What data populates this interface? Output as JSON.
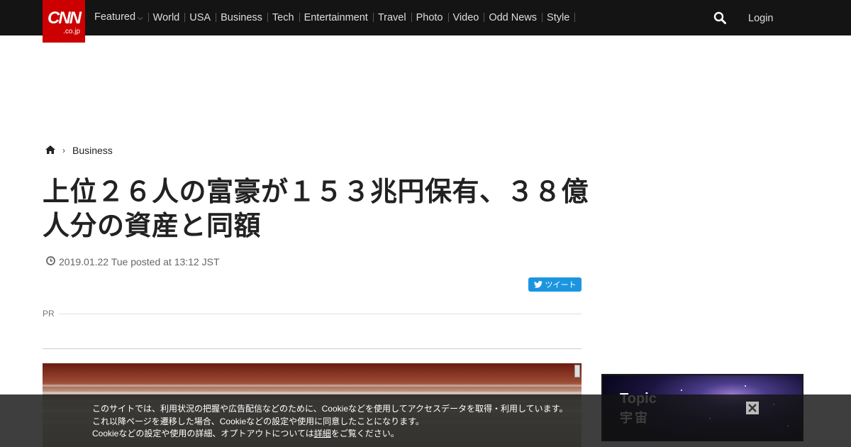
{
  "header": {
    "logo_main": "CNN",
    "logo_sub": ".co.jp",
    "nav": [
      {
        "label": "Featured",
        "has_dropdown": true
      },
      {
        "label": "World"
      },
      {
        "label": "USA"
      },
      {
        "label": "Business"
      },
      {
        "label": "Tech"
      },
      {
        "label": "Entertainment"
      },
      {
        "label": "Travel"
      },
      {
        "label": "Photo"
      },
      {
        "label": "Video"
      },
      {
        "label": "Odd News"
      },
      {
        "label": "Style"
      }
    ],
    "login_label": "Login",
    "search_icon": "search-icon"
  },
  "breadcrumb": {
    "home_icon": "home-icon",
    "section": "Business"
  },
  "article": {
    "title": "上位２６人の富豪が１５３兆円保有、３８億人分の資産と同額",
    "date": "2019.01.22 Tue posted at 13:12 JST",
    "tweet_label": "ツイート",
    "pr_label": "PR"
  },
  "side_ad": {
    "topic": "Topic",
    "sub": "宇宙"
  },
  "cookie_banner": {
    "line1": "このサイトでは、利用状況の把握や広告配信などのために、Cookieなどを使用してアクセスデータを取得・利用しています。",
    "line2": "これ以降ページを遷移した場合、Cookieなどの設定や使用に同意したことになります。",
    "line3_pre": "Cookieなどの設定や使用の詳細、オプトアウトについては",
    "line3_link": "詳細",
    "line3_post": "をご覧ください。"
  },
  "colors": {
    "topbar": "#141414",
    "logo": "#cc0000",
    "twitter": "#1b95e0"
  }
}
